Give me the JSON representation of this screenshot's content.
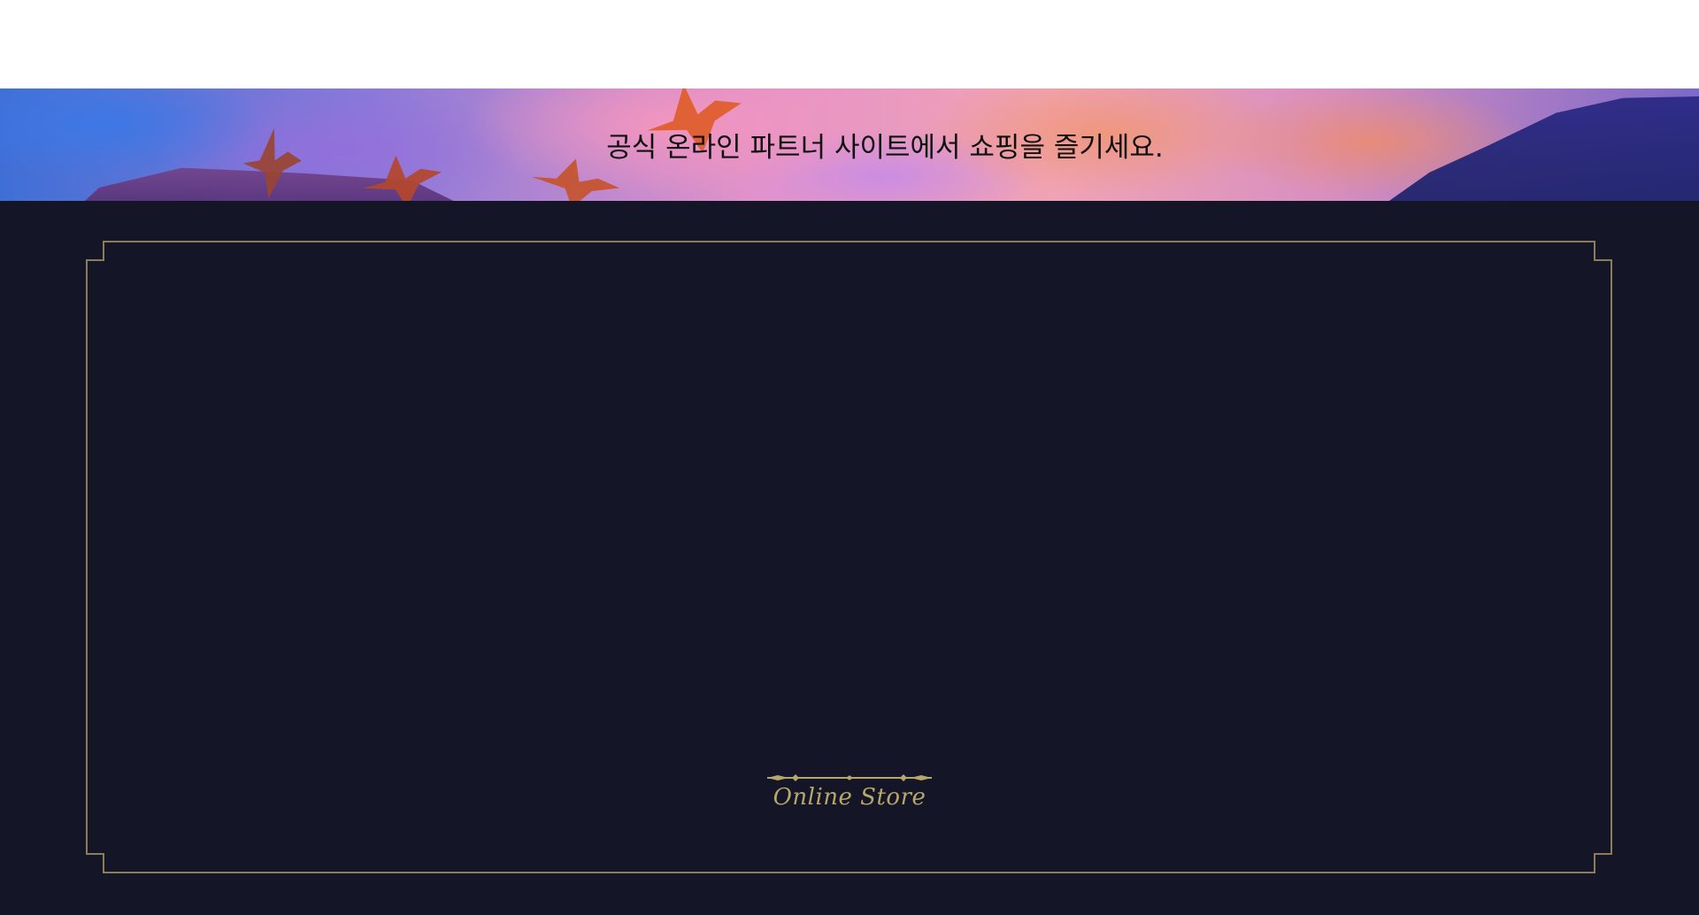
{
  "banner": {
    "text": "공식 온라인 파트너 사이트에서 쇼핑을 즐기세요."
  },
  "store": {
    "name": "Online Store"
  },
  "colors": {
    "background": "#141526",
    "frame": "#8a7d57",
    "accent_gold": "#b7a76b",
    "banner_text": "#101010"
  },
  "icons": [
    "bird-silhouette-icon",
    "ornament-divider-icon"
  ]
}
